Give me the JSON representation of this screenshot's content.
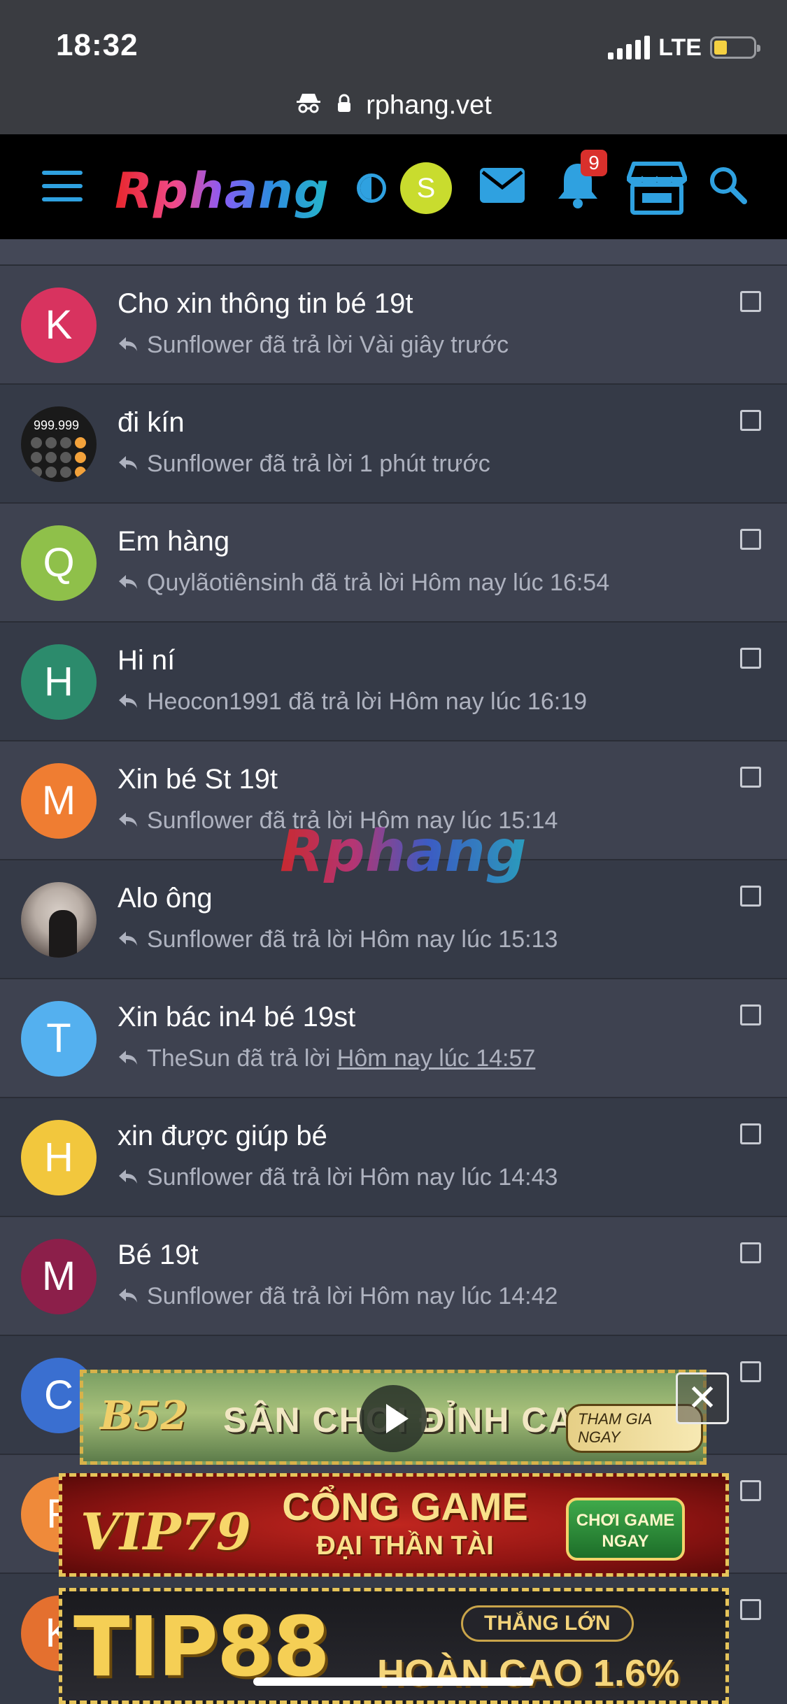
{
  "status_bar": {
    "time": "18:32",
    "network": "LTE"
  },
  "browser": {
    "url": "rphang.vet"
  },
  "header": {
    "logo": "Rphang",
    "user_initial": "S",
    "notification_count": "9"
  },
  "conversations": [
    {
      "title": "Cho xin thông tin bé 19t",
      "user": "Sunflower",
      "action": "đã trả lời",
      "time": "Vài giây trước",
      "avatar_letter": "K",
      "avatar_color": "#d8335f"
    },
    {
      "title": "đi kín",
      "user": "Sunflower",
      "action": "đã trả lời",
      "time": "1 phút trước",
      "avatar_letter": "",
      "avatar_digits": "999.999"
    },
    {
      "title": "Em hàng",
      "user": "Quylãotiênsinh",
      "action": "đã trả lời",
      "time": "Hôm nay lúc 16:54",
      "avatar_letter": "Q",
      "avatar_color": "#8fc04a"
    },
    {
      "title": "Hi ní",
      "user": "Heocon1991",
      "action": "đã trả lời",
      "time": "Hôm nay lúc 16:19",
      "avatar_letter": "H",
      "avatar_color": "#2c8b6c"
    },
    {
      "title": "Xin bé St 19t",
      "user": "Sunflower",
      "action": "đã trả lời",
      "time": "Hôm nay lúc 15:14",
      "avatar_letter": "M",
      "avatar_color": "#ef7d32"
    },
    {
      "title": "Alo ông",
      "user": "Sunflower",
      "action": "đã trả lời",
      "time": "Hôm nay lúc 15:13",
      "avatar_letter": ""
    },
    {
      "title": "Xin bác in4 bé 19st",
      "user": "TheSun",
      "action": "đã trả lời",
      "time": "Hôm nay lúc 14:57",
      "avatar_letter": "T",
      "avatar_color": "#54b0ef"
    },
    {
      "title": "xin được giúp bé",
      "user": "Sunflower",
      "action": "đã trả lời",
      "time": "Hôm nay lúc 14:43",
      "avatar_letter": "H",
      "avatar_color": "#f2c73d"
    },
    {
      "title": "Bé 19t",
      "user": "Sunflower",
      "action": "đã trả lời",
      "time": "Hôm nay lúc 14:42",
      "avatar_letter": "M",
      "avatar_color": "#8c1f4a"
    },
    {
      "title": "",
      "user": "",
      "action": "",
      "time": "",
      "avatar_letter": "C",
      "avatar_color": "#3a6fd0"
    },
    {
      "title": "",
      "user": "",
      "action": "",
      "time": "",
      "avatar_letter": "F",
      "avatar_color": "#ef8a3a"
    },
    {
      "title": "",
      "user": "",
      "action": "",
      "time": "",
      "avatar_letter": "K",
      "avatar_color": "#e4702f"
    }
  ],
  "watermark": "Rphang",
  "ads": {
    "b52": {
      "logo": "B52",
      "text": "SÂN CHƠI ĐỈNH CAO",
      "cta": "THAM GIA NGAY"
    },
    "vip79": {
      "logo": "VIP79",
      "title": "CỔNG GAME",
      "subtitle": "ĐẠI THẦN TÀI",
      "cta": "CHƠI GAME NGAY"
    },
    "tip88": {
      "logo": "TIP88",
      "badge": "THẮNG LỚN",
      "text": "HOÀN CAO 1.6%"
    }
  },
  "colors": {
    "header_bg": "#000000",
    "accent": "#2fa1e0",
    "row_odd": "#3e4250",
    "row_even": "#353a47",
    "badge": "#d9302c"
  },
  "icons": [
    "incognito-icon",
    "lock-icon",
    "menu-icon",
    "contrast-icon",
    "mail-icon",
    "bell-icon",
    "store-icon",
    "search-icon",
    "reply-icon",
    "play-icon",
    "close-icon"
  ]
}
